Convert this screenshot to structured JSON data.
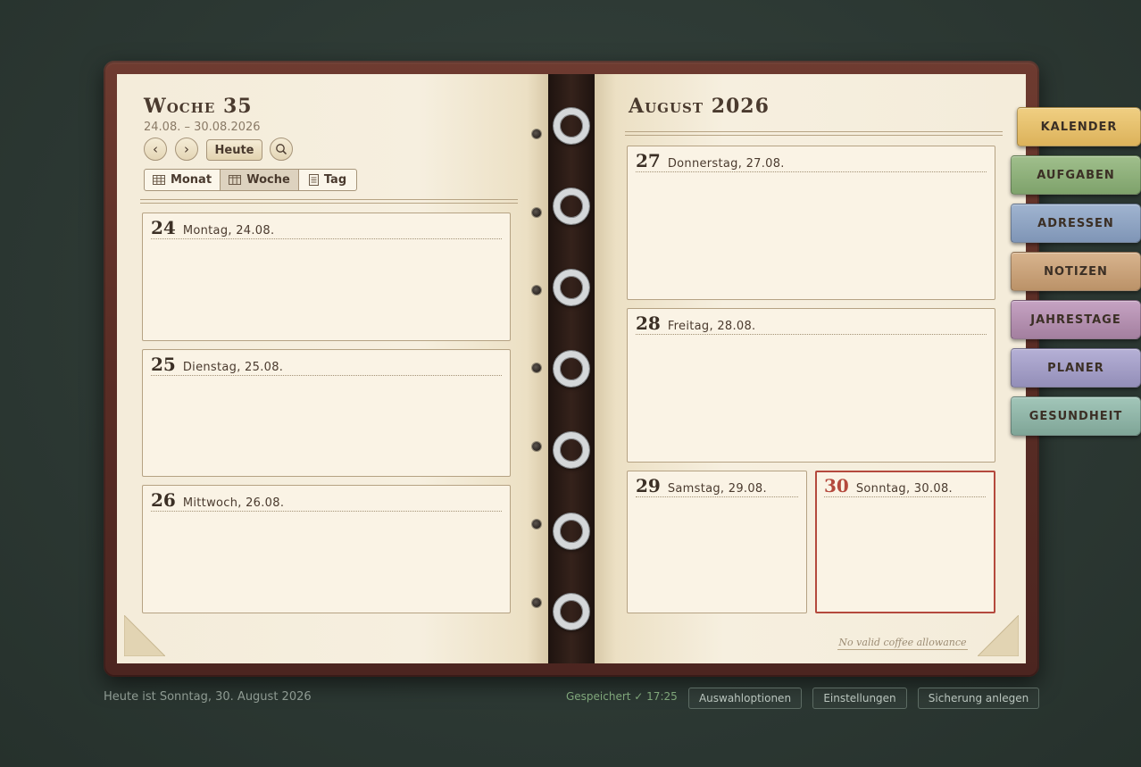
{
  "left_page": {
    "week_title": "Woche 35",
    "week_range": "24.08. – 30.08.2026",
    "prev_symbol": "‹",
    "next_symbol": "›",
    "today_label": "Heute",
    "views": [
      {
        "label": "Monat",
        "icon": "month-grid-icon",
        "active": false
      },
      {
        "label": "Woche",
        "icon": "week-columns-icon",
        "active": true
      },
      {
        "label": "Tag",
        "icon": "day-page-icon",
        "active": false
      }
    ],
    "days": [
      {
        "num": "24",
        "label": "Montag, 24.08."
      },
      {
        "num": "25",
        "label": "Dienstag, 25.08."
      },
      {
        "num": "26",
        "label": "Mittwoch, 26.08."
      }
    ]
  },
  "right_page": {
    "month_title": "August 2026",
    "days": [
      {
        "num": "27",
        "label": "Donnerstag, 27.08."
      },
      {
        "num": "28",
        "label": "Freitag, 28.08."
      },
      {
        "num": "29",
        "label": "Samstag, 29.08."
      },
      {
        "num": "30",
        "label": "Sonntag, 30.08.",
        "today": true
      }
    ],
    "footnote": "No valid coffee allowance"
  },
  "tabs": [
    {
      "label": "KALENDER",
      "color": "#e6c06c",
      "active": true
    },
    {
      "label": "AUFGABEN",
      "color": "#8fb07a"
    },
    {
      "label": "ADRESSEN",
      "color": "#8ea3c2"
    },
    {
      "label": "NOTIZEN",
      "color": "#c9a27a"
    },
    {
      "label": "JAHRESTAGE",
      "color": "#b28fb0"
    },
    {
      "label": "PLANER",
      "color": "#a19cc4"
    },
    {
      "label": "GESUNDHEIT",
      "color": "#8db3a7"
    }
  ],
  "footer": {
    "status": "Heute ist Sonntag, 30. August 2026",
    "saved": "Gespeichert ✓ 17:25",
    "buttons": [
      "Auswahloptionen",
      "Einstellungen",
      "Sicherung anlegen"
    ]
  },
  "colors": {
    "today_accent": "#b4493d",
    "binder_leather": "#5a2d25",
    "paper": "#f4ecda"
  }
}
